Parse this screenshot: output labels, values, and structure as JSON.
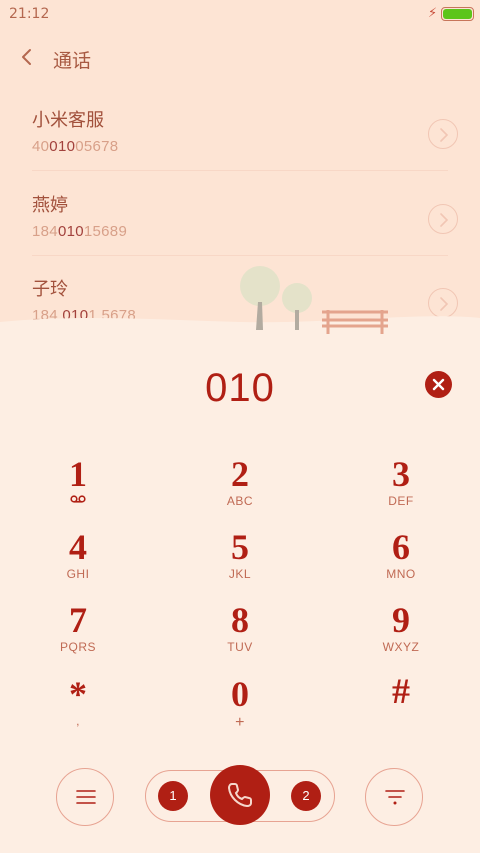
{
  "status": {
    "time": "21:12"
  },
  "header": {
    "title": "通话"
  },
  "contacts": [
    {
      "name": "小米客服",
      "num_pre": "40",
      "num_hl": "010",
      "num_post": "05678"
    },
    {
      "name": "燕婷",
      "num_pre": "184",
      "num_hl": "010",
      "num_post": "15689"
    },
    {
      "name": "子玲",
      "num_pre": "184 ",
      "num_hl": "010",
      "num_post": "1 5678"
    }
  ],
  "dial": {
    "input": "010"
  },
  "keys": [
    {
      "digit": "1",
      "letters": ""
    },
    {
      "digit": "2",
      "letters": "ABC"
    },
    {
      "digit": "3",
      "letters": "DEF"
    },
    {
      "digit": "4",
      "letters": "GHI"
    },
    {
      "digit": "5",
      "letters": "JKL"
    },
    {
      "digit": "6",
      "letters": "MNO"
    },
    {
      "digit": "7",
      "letters": "PQRS"
    },
    {
      "digit": "8",
      "letters": "TUV"
    },
    {
      "digit": "9",
      "letters": "WXYZ"
    },
    {
      "digit": "*",
      "letters": ","
    },
    {
      "digit": "0",
      "letters": "+"
    },
    {
      "digit": "#",
      "letters": ""
    }
  ],
  "bottom": {
    "sim1": "1",
    "sim2": "2"
  },
  "icons": {
    "back": "chevron-left-icon",
    "contact_go": "chevron-right-icon",
    "clear": "close-icon",
    "voicemail": "voicemail-icon",
    "menu": "menu-icon",
    "call": "phone-icon",
    "collapse": "collapse-dialpad-icon"
  },
  "colors": {
    "accent": "#b01f14",
    "background": "#fdeee3",
    "top_background": "#fde4d4"
  }
}
